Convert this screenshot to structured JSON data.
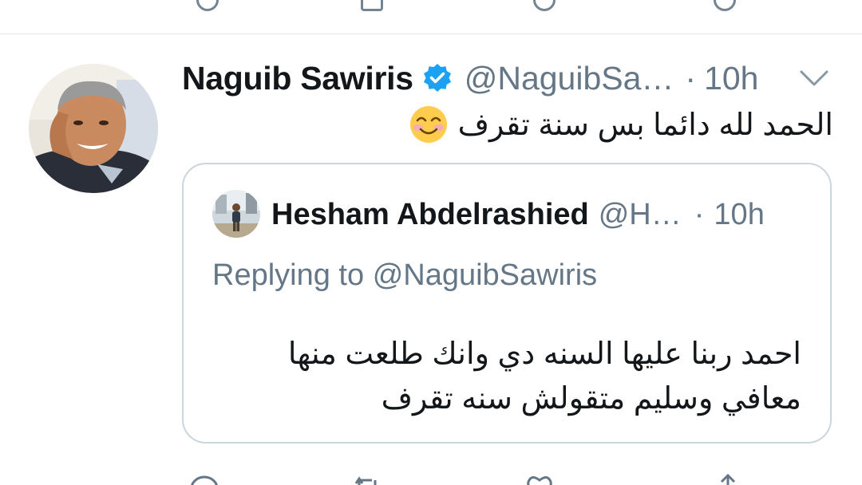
{
  "tweet": {
    "author_name": "Naguib Sawiris",
    "author_handle": "@NaguibSa…",
    "separator": "·",
    "time": "10h",
    "text": "الحمد لله دائما بس سنة تقرف",
    "emoji": "smiling-face-icon"
  },
  "quoted": {
    "author_name": "Hesham Abdelrashied",
    "author_handle": "@H…",
    "separator": "·",
    "time": "10h",
    "replying_prefix": "Replying to",
    "replying_handle": "@NaguibSawiris",
    "text_line1": "احمد ربنا عليها السنه دي وانك طلعت منها",
    "text_line2": "معافي وسليم متقولش سنه تقرف"
  },
  "colors": {
    "text": "#14171a",
    "secondary": "#657786",
    "verified": "#1da1f2",
    "border": "#ccd6dd"
  }
}
